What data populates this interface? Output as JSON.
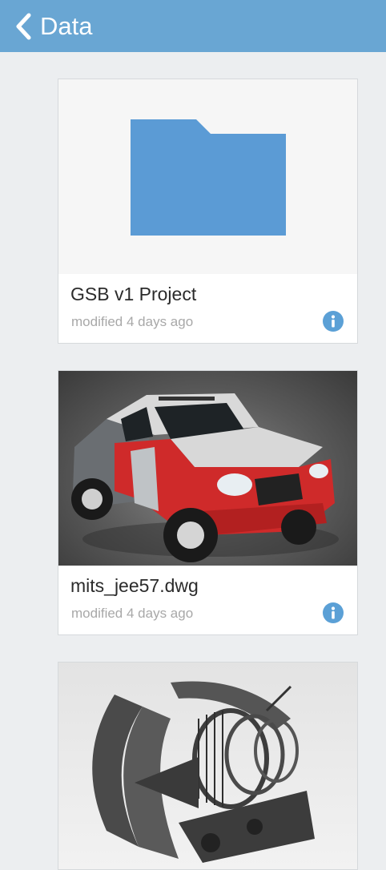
{
  "header": {
    "title": "Data",
    "back_icon": "chevron-left-icon",
    "background_color": "#69a6d3"
  },
  "files": [
    {
      "name": "GSB v1 Project",
      "meta": "modified 4 days ago",
      "thumbnail": "folder-icon",
      "folder_color": "#5b9bd5",
      "info_icon": "info-icon"
    },
    {
      "name": "mits_jee57.dwg",
      "meta": "modified 4 days ago",
      "thumbnail": "red-pickup-truck-render",
      "info_icon": "info-icon"
    },
    {
      "name": "",
      "meta": "",
      "thumbnail": "jet-engine-cutaway-render"
    }
  ]
}
